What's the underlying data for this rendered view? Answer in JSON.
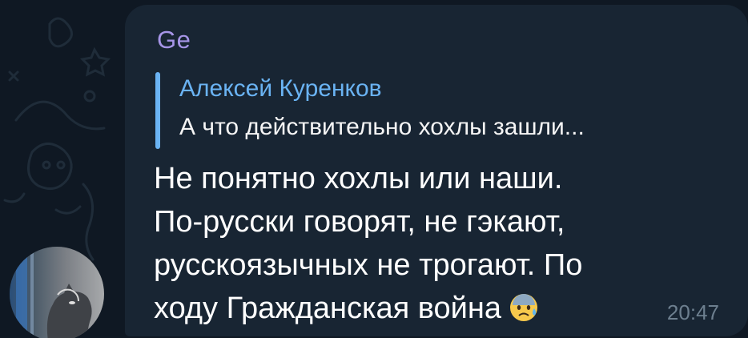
{
  "message": {
    "sender_name": "Ge",
    "reply": {
      "author": "Алексей Куренков",
      "text": "А что действительно хохлы зашли..."
    },
    "text_lines": [
      "Не понятно хохлы или наши.",
      "По-русски говорят, не гэкают,",
      "русскоязычных не трогают. По",
      "ходу Гражданская война"
    ],
    "emoji": "anxious-face-with-sweat",
    "time": "20:47"
  },
  "colors": {
    "background": "#0f1823",
    "bubble": "#182533",
    "sender": "#a695e7",
    "reply_accent": "#6ab3f3",
    "text": "#ffffff",
    "time": "#6d7f8f"
  }
}
